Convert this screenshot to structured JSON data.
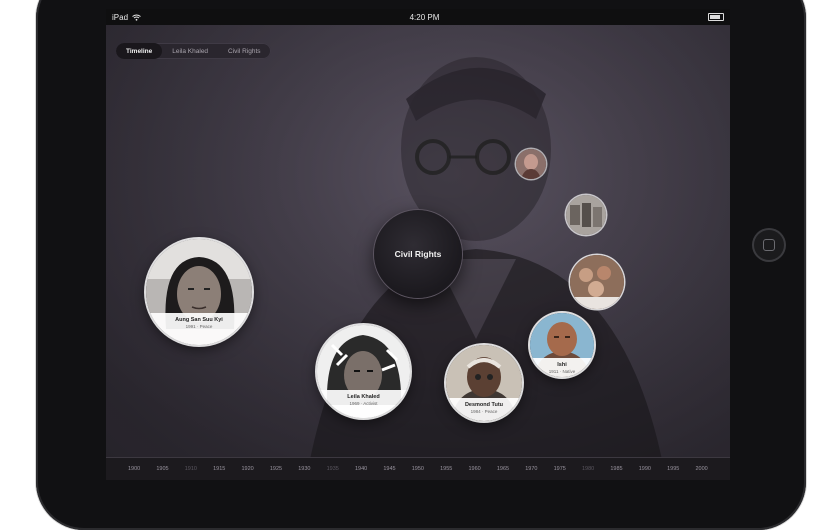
{
  "status_bar": {
    "carrier": "iPad",
    "wifi_icon": "wifi-icon",
    "time": "4:20 PM",
    "battery_icon": "battery-icon"
  },
  "tabs": [
    {
      "label": "Timeline",
      "active": true
    },
    {
      "label": "Leila Khaled",
      "active": false
    },
    {
      "label": "Civil Rights",
      "active": false
    }
  ],
  "center_topic": {
    "label": "Civil Rights"
  },
  "bubbles": [
    {
      "name": "Aung San Suu Kyi",
      "meta": "1991 · Peace"
    },
    {
      "name": "Leila Khaled",
      "meta": "1969 · Activist"
    },
    {
      "name": "Desmond Tutu",
      "meta": "1984 · Peace"
    },
    {
      "name": "Ishi",
      "meta": "1911 · Native"
    }
  ],
  "timeline": {
    "years": [
      "1900",
      "1905",
      "1910",
      "1915",
      "1920",
      "1925",
      "1930",
      "1935",
      "1940",
      "1945",
      "1950",
      "1955",
      "1960",
      "1965",
      "1970",
      "1975",
      "1980",
      "1985",
      "1990",
      "1995",
      "2000"
    ],
    "dim_years": [
      "1910",
      "1935",
      "1980"
    ]
  },
  "colors": {
    "screen_bg": "#4b4552",
    "bezel": "#111113",
    "bubble_caption": "#ffffff",
    "center_bubble": "#1b191e"
  }
}
